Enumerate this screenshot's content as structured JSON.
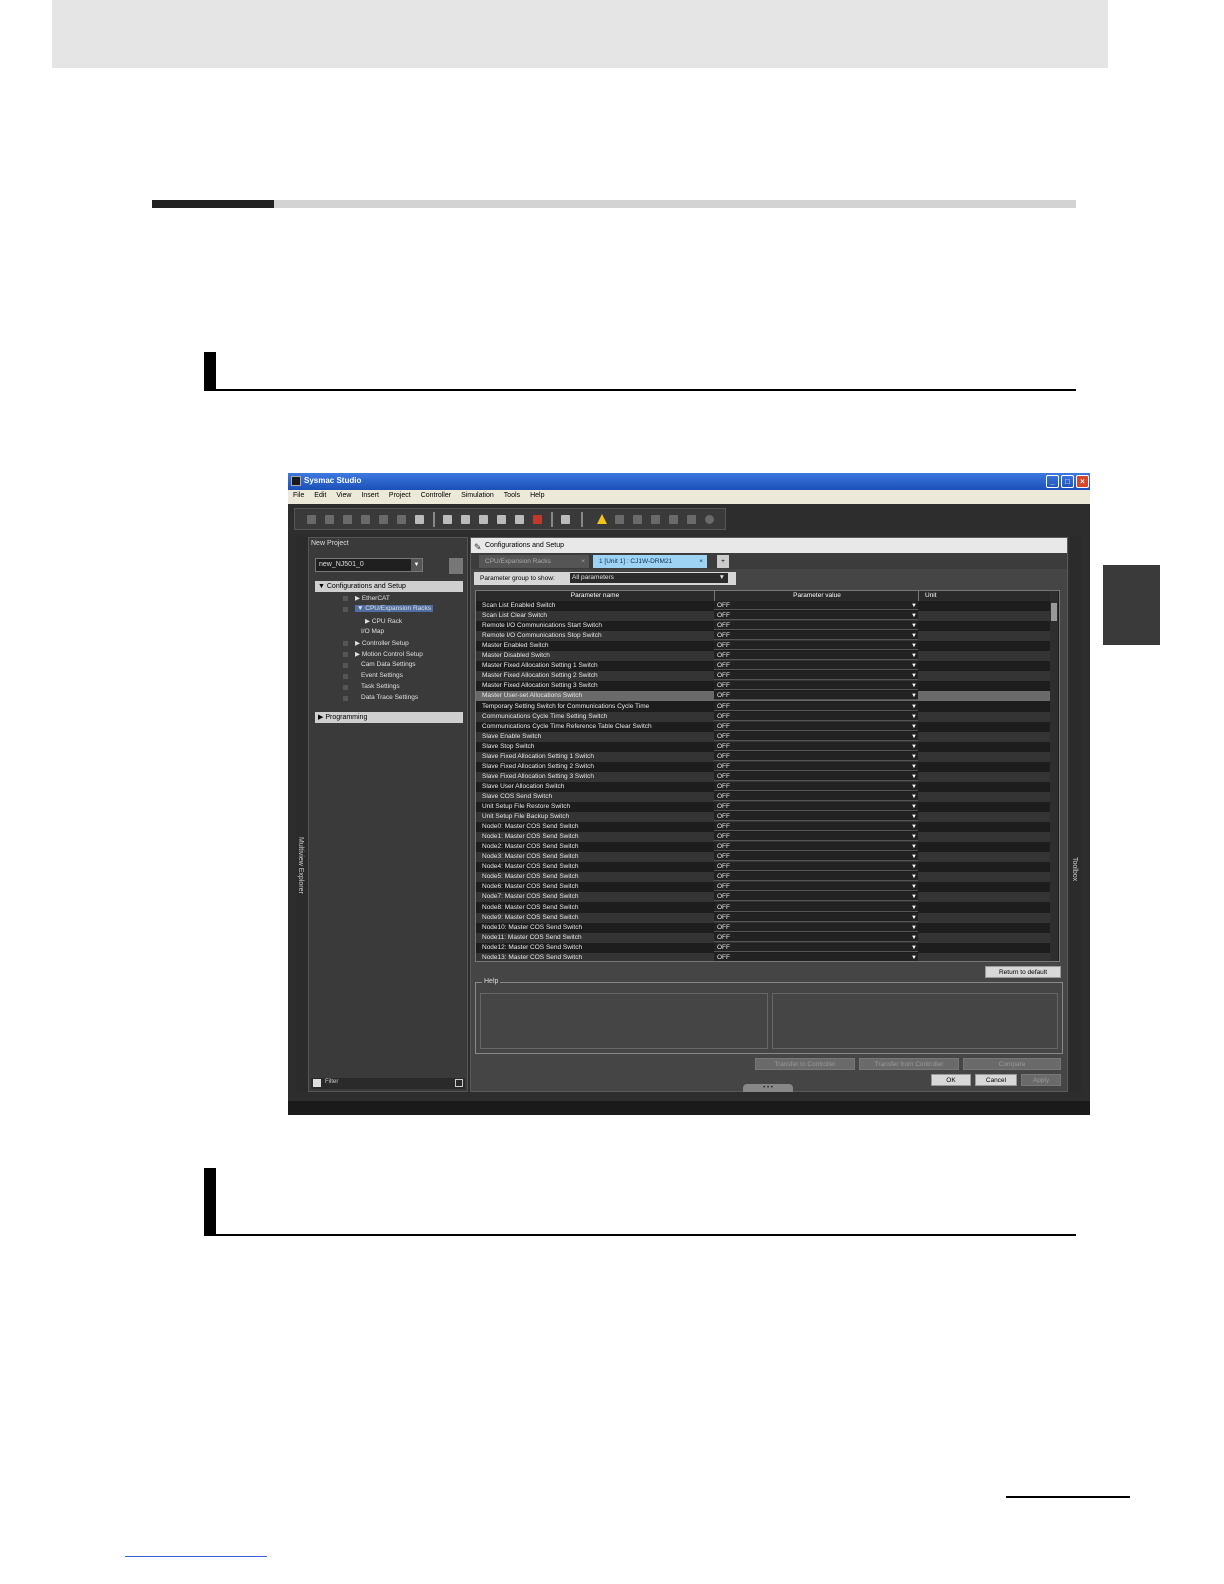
{
  "window": {
    "title": "Sysmac Studio",
    "menu": [
      "File",
      "Edit",
      "View",
      "Insert",
      "Project",
      "Controller",
      "Simulation",
      "Tools",
      "Help"
    ]
  },
  "explorer": {
    "title": "New Project",
    "device": "new_NJ501_0",
    "config_header": "Configurations and Setup",
    "tree": [
      {
        "label": "EtherCAT"
      },
      {
        "label": "CPU/Expansion Racks"
      },
      {
        "label": "CPU Rack"
      },
      {
        "label": "I/O Map"
      },
      {
        "label": "Controller Setup"
      },
      {
        "label": "Motion Control Setup"
      },
      {
        "label": "Cam Data Settings"
      },
      {
        "label": "Event Settings"
      },
      {
        "label": "Task Settings"
      },
      {
        "label": "Data Trace Settings"
      }
    ],
    "programming_header": "Programming",
    "filter_label": "Filter",
    "side_label": "Multiview Explorer"
  },
  "toolbox_label": "Toolbox",
  "main": {
    "header": "Configurations and Setup",
    "tabs": [
      "CPU/Expansion Racks",
      "1 [Unit 1] : CJ1W-DRM21"
    ],
    "param_group_label": "Parameter group to show:",
    "param_group_value": "All parameters",
    "columns": [
      "Parameter name",
      "Parameter value",
      "Unit"
    ],
    "rows": [
      {
        "name": "Scan List Enabled Switch",
        "value": "OFF"
      },
      {
        "name": "Scan List Clear Switch",
        "value": "OFF"
      },
      {
        "name": "Remote I/O Communications Start Switch",
        "value": "OFF"
      },
      {
        "name": "Remote I/O Communications Stop Switch",
        "value": "OFF"
      },
      {
        "name": "Master Enabled Switch",
        "value": "OFF"
      },
      {
        "name": "Master Disabled Switch",
        "value": "OFF"
      },
      {
        "name": "Master Fixed Allocation Setting 1 Switch",
        "value": "OFF"
      },
      {
        "name": "Master Fixed Allocation Setting 2 Switch",
        "value": "OFF"
      },
      {
        "name": "Master Fixed Allocation Setting 3 Switch",
        "value": "OFF"
      },
      {
        "name": "Master User-set Allocations Switch",
        "value": "OFF"
      },
      {
        "name": "Temporary Setting Switch for Communications Cycle Time",
        "value": "OFF"
      },
      {
        "name": "Communications Cycle Time Setting Switch",
        "value": "OFF"
      },
      {
        "name": "Communications Cycle Time Reference Table Clear Switch",
        "value": "OFF"
      },
      {
        "name": "Slave Enable Switch",
        "value": "OFF"
      },
      {
        "name": "Slave Stop Switch",
        "value": "OFF"
      },
      {
        "name": "Slave Fixed Allocation Setting 1 Switch",
        "value": "OFF"
      },
      {
        "name": "Slave Fixed Allocation Setting 2 Switch",
        "value": "OFF"
      },
      {
        "name": "Slave Fixed Allocation Setting 3 Switch",
        "value": "OFF"
      },
      {
        "name": "Slave User Allocation Switch",
        "value": "OFF"
      },
      {
        "name": "Slave COS Send Switch",
        "value": "OFF"
      },
      {
        "name": "Unit Setup File Restore Switch",
        "value": "OFF"
      },
      {
        "name": "Unit Setup File Backup Switch",
        "value": "OFF"
      },
      {
        "name": "Node0: Master COS Send Switch",
        "value": "OFF"
      },
      {
        "name": "Node1: Master COS Send Switch",
        "value": "OFF"
      },
      {
        "name": "Node2: Master COS Send Switch",
        "value": "OFF"
      },
      {
        "name": "Node3: Master COS Send Switch",
        "value": "OFF"
      },
      {
        "name": "Node4: Master COS Send Switch",
        "value": "OFF"
      },
      {
        "name": "Node5: Master COS Send Switch",
        "value": "OFF"
      },
      {
        "name": "Node6: Master COS Send Switch",
        "value": "OFF"
      },
      {
        "name": "Node7: Master COS Send Switch",
        "value": "OFF"
      },
      {
        "name": "Node8: Master COS Send Switch",
        "value": "OFF"
      },
      {
        "name": "Node9: Master COS Send Switch",
        "value": "OFF"
      },
      {
        "name": "Node10: Master COS Send Switch",
        "value": "OFF"
      },
      {
        "name": "Node11: Master COS Send Switch",
        "value": "OFF"
      },
      {
        "name": "Node12: Master COS Send Switch",
        "value": "OFF"
      },
      {
        "name": "Node13: Master COS Send Switch",
        "value": "OFF"
      }
    ],
    "return_default": "Return to default",
    "help_label": "Help",
    "transfer_to": "Transfer to Controller",
    "transfer_from": "Transfer from Controller",
    "compare": "Compare",
    "ok": "OK",
    "cancel": "Cancel",
    "apply": "Apply"
  }
}
